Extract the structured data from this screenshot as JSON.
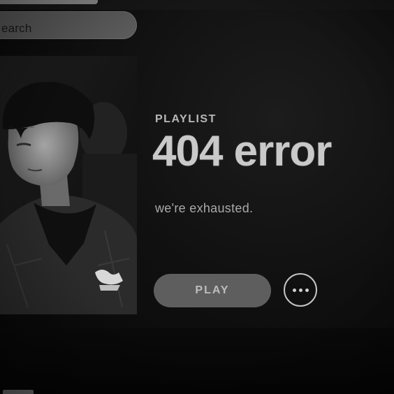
{
  "search": {
    "text": "earch"
  },
  "playlist": {
    "type_label": "PLAYLIST",
    "title": "404 error",
    "description": "we're exhausted."
  },
  "actions": {
    "play_label": "PLAY",
    "more_icon": "ellipsis-icon"
  },
  "colors": {
    "background": "#0b0b0b",
    "title": "#c9c9c9",
    "play_button": "#5e5e5e",
    "search_box": "#5a5a5a"
  }
}
